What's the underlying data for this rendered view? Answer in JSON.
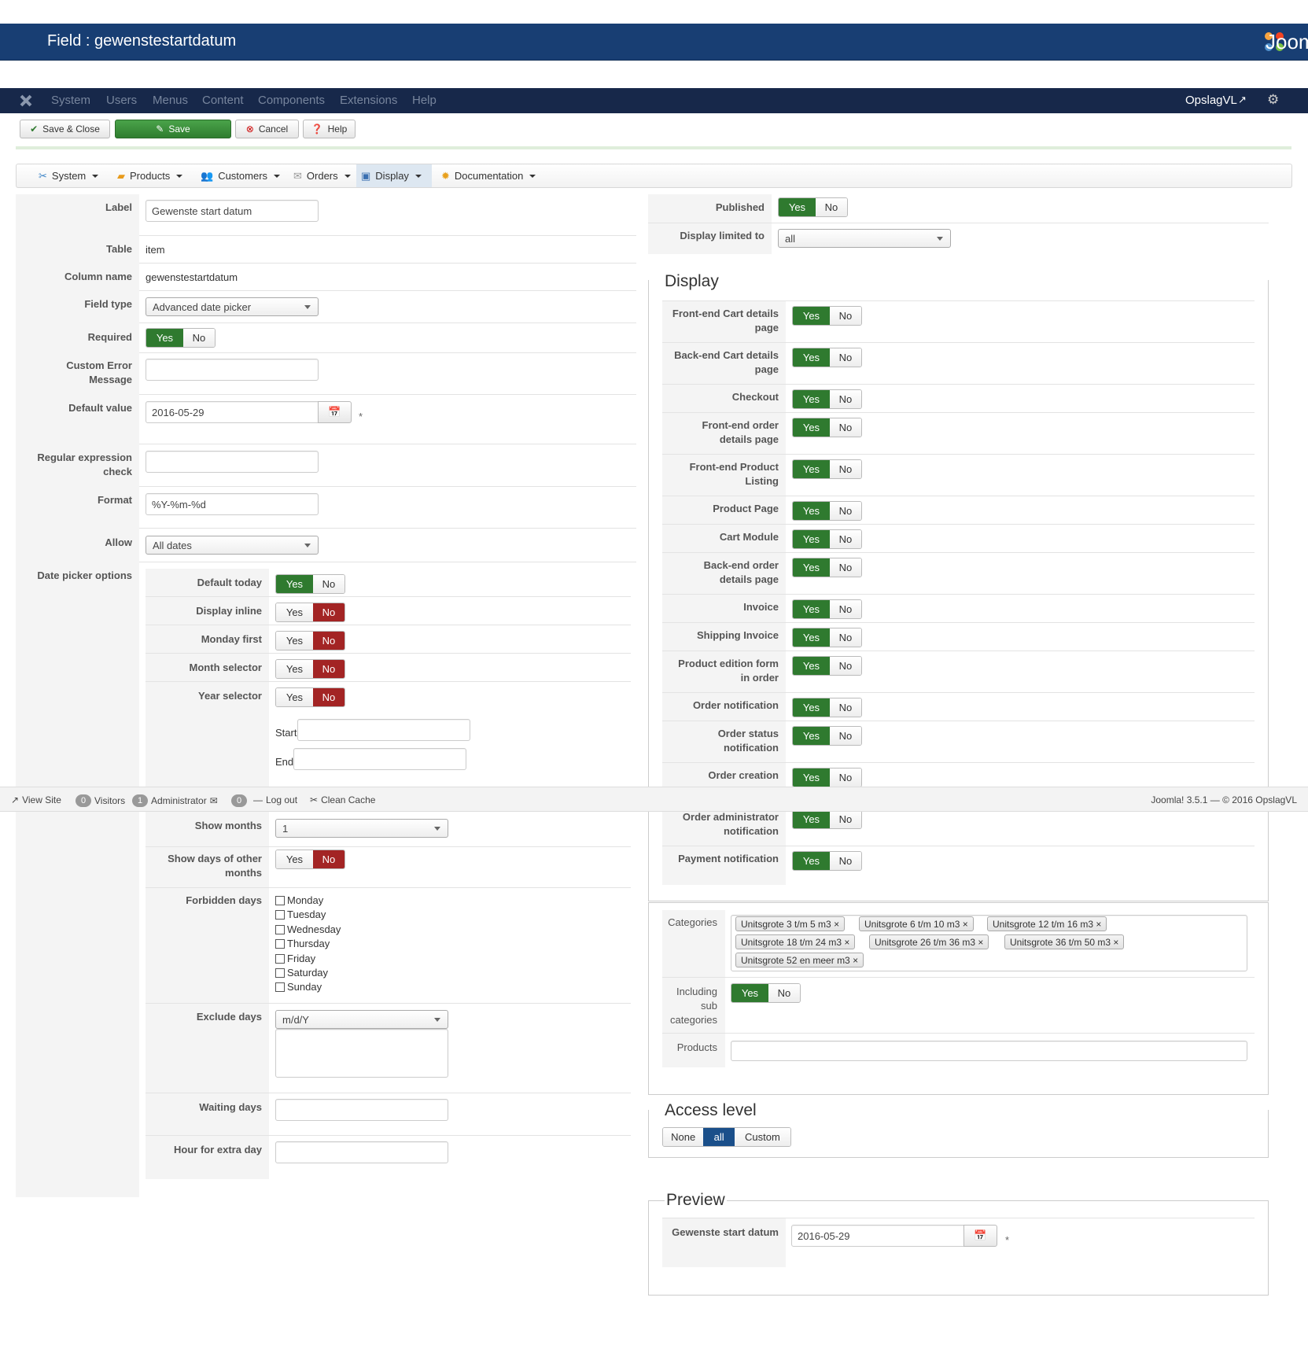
{
  "header": {
    "title": "Field : gewenstestartdatum",
    "brand": "Joomla!"
  },
  "topnav": {
    "items": [
      "System",
      "Users",
      "Menus",
      "Content",
      "Components",
      "Extensions",
      "Help"
    ],
    "site": "OpslagVL"
  },
  "toolbar": {
    "save_close": "Save & Close",
    "save": "Save",
    "cancel": "Cancel",
    "help": "Help"
  },
  "submenu": {
    "items": [
      "System",
      "Products",
      "Customers",
      "Orders",
      "Display",
      "Documentation"
    ],
    "active": "Display"
  },
  "left": {
    "label_lbl": "Label",
    "label_val": "Gewenste start datum",
    "table_lbl": "Table",
    "table_val": "item",
    "column_lbl": "Column name",
    "column_val": "gewenstestartdatum",
    "fieldtype_lbl": "Field type",
    "fieldtype_val": "Advanced date picker",
    "required_lbl": "Required",
    "customerr_lbl1": "Custom Error",
    "customerr_lbl2": "Message",
    "default_lbl": "Default value",
    "default_val": "2016-05-29",
    "star": "*",
    "regex_lbl1": "Regular expression",
    "regex_lbl2": "check",
    "format_lbl": "Format",
    "format_val": "%Y-%m-%d",
    "allow_lbl": "Allow",
    "allow_val": "All dates",
    "dpo_lbl": "Date picker options",
    "default_today": "Default today",
    "display_inline": "Display inline",
    "monday_first": "Monday first",
    "month_selector": "Month selector",
    "year_selector": "Year selector",
    "start": "Start",
    "end": "End",
    "show_months": "Show months",
    "show_months_val": "1",
    "show_days1": "Show days of other",
    "show_days2": "months",
    "forbidden": "Forbidden days",
    "days": [
      "Monday",
      "Tuesday",
      "Wednesday",
      "Thursday",
      "Friday",
      "Saturday",
      "Sunday"
    ],
    "exclude": "Exclude days",
    "exclude_val": "m/d/Y",
    "waiting": "Waiting days",
    "hour_extra": "Hour for extra day"
  },
  "yes": "Yes",
  "no": "No",
  "right": {
    "published": "Published",
    "display_limited": "Display limited to",
    "display_limited_val": "all",
    "display_title": "Display",
    "display_rows": [
      [
        "Front-end Cart details",
        "page"
      ],
      [
        "Back-end Cart details",
        "page"
      ],
      [
        "Checkout",
        ""
      ],
      [
        "Front-end order",
        "details page"
      ],
      [
        "Front-end Product",
        "Listing"
      ],
      [
        "Product Page",
        ""
      ],
      [
        "Cart Module",
        ""
      ],
      [
        "Back-end order",
        "details page"
      ],
      [
        "Invoice",
        ""
      ],
      [
        "Shipping Invoice",
        ""
      ],
      [
        "Product edition form",
        "in order"
      ],
      [
        "Order notification",
        ""
      ],
      [
        "Order status",
        "notification"
      ],
      [
        "Order creation",
        ""
      ],
      [
        "Order administrator",
        "notification"
      ],
      [
        "Payment notification",
        ""
      ]
    ],
    "categories_lbl": "Categories",
    "categories": [
      "Unitsgrote 3 t/m 5 m3",
      "Unitsgrote 6 t/m 10 m3",
      "Unitsgrote 12 t/m 16 m3",
      "Unitsgrote 18 t/m 24 m3",
      "Unitsgrote 26 t/m 36 m3",
      "Unitsgrote 36 t/m 50 m3",
      "Unitsgrote 52 en meer m3"
    ],
    "incl_sub1": "Including",
    "incl_sub2": "sub",
    "incl_sub3": "categories",
    "products": "Products",
    "access_title": "Access level",
    "access": [
      "None",
      "all",
      "Custom"
    ],
    "preview_title": "Preview",
    "preview_lbl": "Gewenste start datum",
    "preview_val": "2016-05-29"
  },
  "status": {
    "view_site": "View Site",
    "visitors_count": "0",
    "visitors": "Visitors",
    "admin_count": "1",
    "admin": "Administrator",
    "msg_count": "0",
    "logout": "Log out",
    "clean": "Clean Cache",
    "version": "Joomla! 3.5.1 — © 2016 OpslagVL"
  }
}
